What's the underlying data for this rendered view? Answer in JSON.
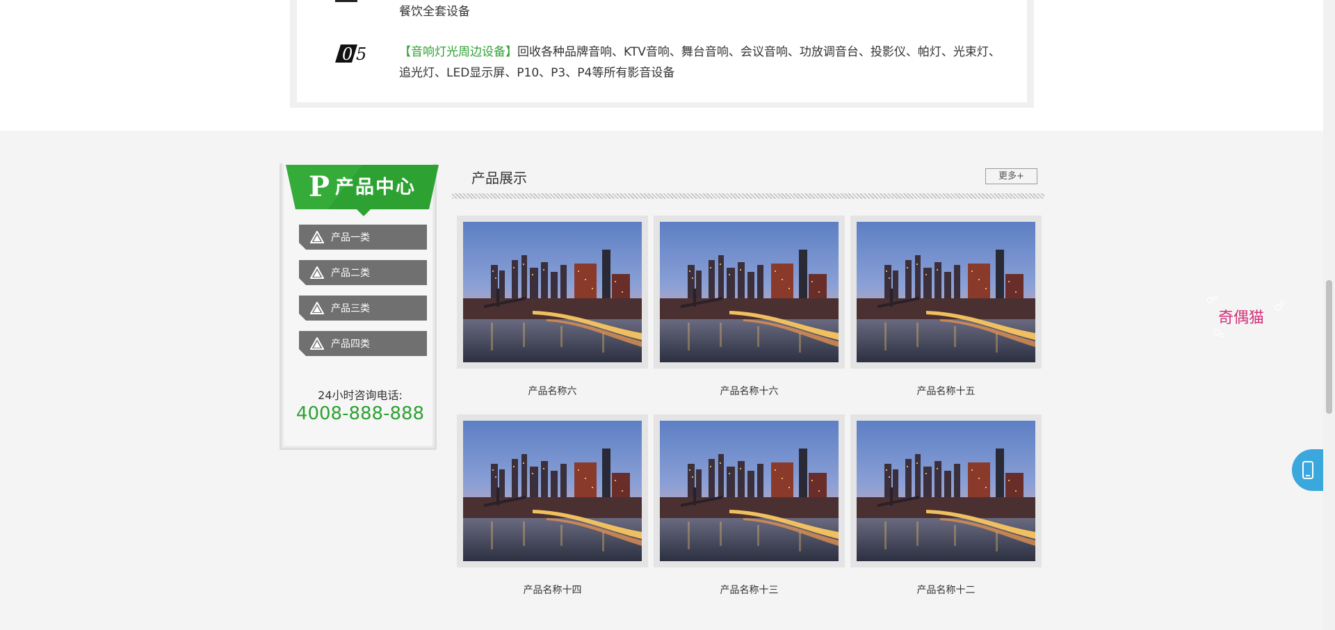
{
  "top": {
    "line1": "餐饮全套设备",
    "item5_number": "05",
    "item5_highlight": "【音响灯光周边设备】",
    "item5_text": "回收各种品牌音响、KTV音响、舞台音响、会议音响、功放调音台、投影仪、帕灯、光束灯、追光灯、LED显示屏、P10、P3、P4等所有影音设备"
  },
  "sidebar": {
    "title_letter": "P",
    "title": "产品中心",
    "categories": [
      "产品一类",
      "产品二类",
      "产品三类",
      "产品四类"
    ],
    "hotline_label": "24小时咨询电话:",
    "hotline": "4008-888-888"
  },
  "products": {
    "title": "产品展示",
    "more": "更多+",
    "items": [
      "产品名称六",
      "产品名称十六",
      "产品名称十五",
      "产品名称十四",
      "产品名称十三",
      "产品名称十二"
    ]
  },
  "mascot_text": "奇偶猫",
  "colors": {
    "accent_green": "#2ea133",
    "category_gray": "#707070",
    "mobile_blue": "#3aa7dd"
  }
}
